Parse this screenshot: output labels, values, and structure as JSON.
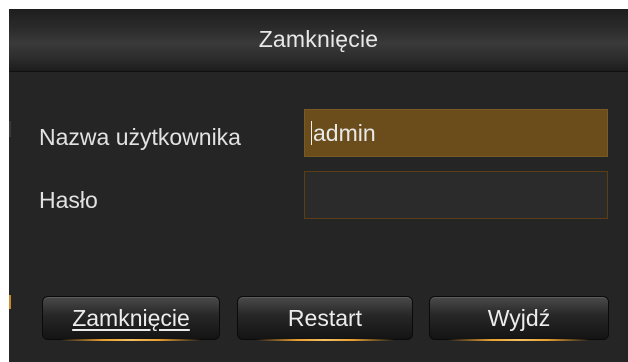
{
  "dialog": {
    "title": "Zamknięcie"
  },
  "form": {
    "username_label": "Nazwa użytkownika",
    "username_value": "admin",
    "password_label": "Hasło",
    "password_value": ""
  },
  "buttons": {
    "shutdown_label": "Zamknięcie",
    "restart_label": "Restart",
    "exit_label": "Wyjdź"
  },
  "colors": {
    "dialog_background": "#252525",
    "active_field": "#6b4d1b",
    "accent_glow": "#e8a030",
    "text": "#e8e8e8"
  }
}
